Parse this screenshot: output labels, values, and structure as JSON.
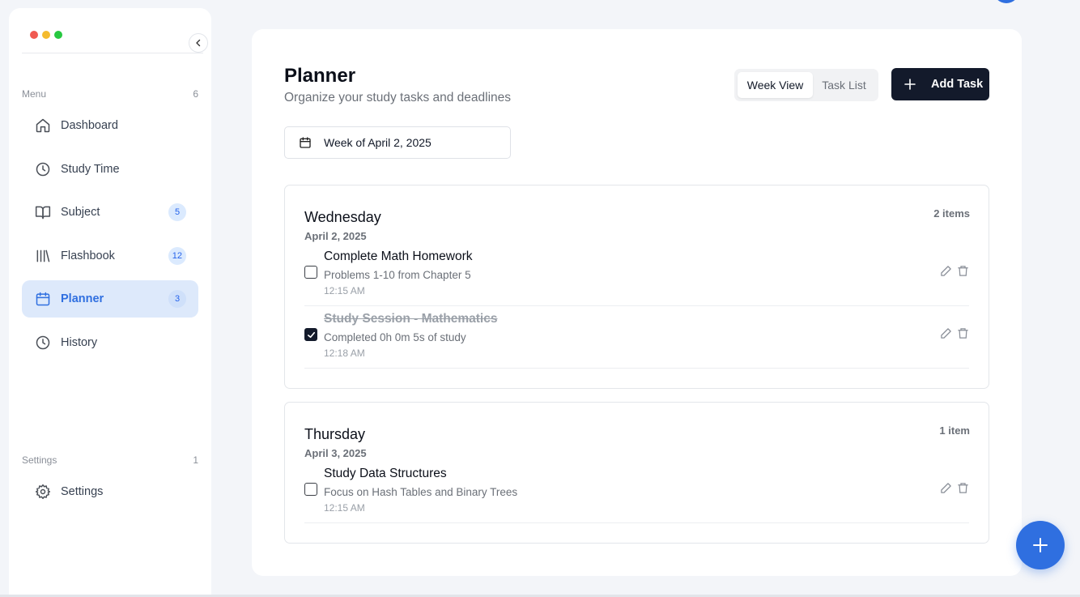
{
  "sidebar": {
    "traffic_colors": [
      "#f05a51",
      "#f4bb2f",
      "#27c840"
    ],
    "menu_header": {
      "label": "Menu",
      "count": "6"
    },
    "items": [
      {
        "label": "Dashboard",
        "icon": "home-icon",
        "badge": null
      },
      {
        "label": "Study Time",
        "icon": "clock-icon",
        "badge": null
      },
      {
        "label": "Subject",
        "icon": "book-icon",
        "badge": "5"
      },
      {
        "label": "Flashbook",
        "icon": "library-icon",
        "badge": "12"
      },
      {
        "label": "Planner",
        "icon": "calendar-icon",
        "badge": "3",
        "active": true
      },
      {
        "label": "History",
        "icon": "clock-icon",
        "badge": null
      }
    ],
    "settings_header": {
      "label": "Settings",
      "count": "1"
    },
    "settings_item": {
      "label": "Settings",
      "icon": "gear-icon"
    }
  },
  "main": {
    "title": "Planner",
    "subtitle": "Organize your study tasks and deadlines",
    "view_toggle": {
      "selected": "Week View",
      "other": "Task List"
    },
    "add_task_label": "Add Task",
    "week_label": "Week of April 2, 2025",
    "days": [
      {
        "name": "Wednesday",
        "date": "April 2, 2025",
        "count": "2 items",
        "tasks": [
          {
            "title": "Complete Math Homework",
            "description": "Problems 1-10 from Chapter 5",
            "time": "12:15 AM",
            "completed": false
          },
          {
            "title": "Study Session - Mathematics",
            "description": "Completed 0h 0m 5s of study",
            "time": "12:18 AM",
            "completed": true
          }
        ]
      },
      {
        "name": "Thursday",
        "date": "April 3, 2025",
        "count": "1 item",
        "tasks": [
          {
            "title": "Study Data Structures",
            "description": "Focus on Hash Tables and Binary Trees",
            "time": "12:15 AM",
            "completed": false
          }
        ]
      }
    ]
  },
  "colors": {
    "accent": "#2f6fe0",
    "dark_button": "#131a2b",
    "active_nav_bg": "#dde9fb"
  }
}
